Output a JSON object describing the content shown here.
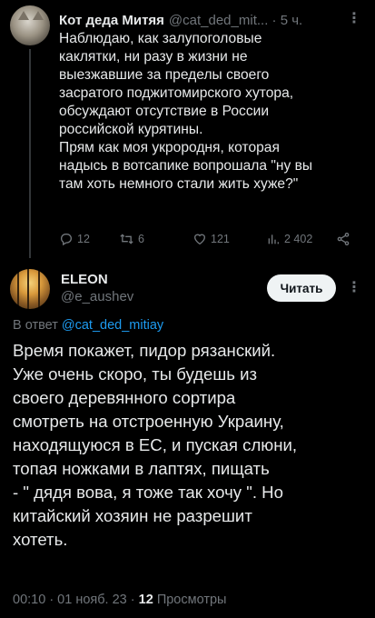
{
  "parent_tweet": {
    "author_name": "Кот деда Митяя",
    "handle": "@cat_ded_mit...",
    "separator": "·",
    "time": "5 ч.",
    "text_lines": [
      "Наблюдаю, как залупоголовые",
      "каклятки, ни разу в жизни не",
      "выезжавшие за пределы своего",
      "засратого поджитомирского хутора,",
      "обсуждают отсутствие в России",
      "российской курятины.",
      "Прям как моя укрородня, которая",
      "надысь в вотсапике вопрошала \"ну вы",
      "там хоть немного стали жить хуже?\""
    ],
    "replies": "12",
    "retweets": "6",
    "likes": "121",
    "views": "2 402"
  },
  "reply_tweet": {
    "author_name": "ELEON",
    "handle": "@e_aushev",
    "follow_label": "Читать",
    "reply_to_prefix": "В ответ",
    "reply_to_handle": "@cat_ded_mitiay",
    "text_lines": [
      "Время покажет, пидор рязанский.",
      "Уже очень скоро, ты будешь из",
      "своего деревянного сортира",
      "смотреть на отстроенную Украину,",
      "находящуюся в ЕС, и пуская слюни,",
      "топая ножками в лаптях, пищать",
      "- \" дядя вова, я тоже так хочу \". Но",
      "китайский хозяин не разрешит",
      "хотеть."
    ],
    "meta_time": "00:10 · 01 нояб. 23 ·",
    "views_count": "12",
    "views_label": "Просмотры"
  },
  "colors": {
    "background": "#000000",
    "text": "#e7e9ea",
    "secondary": "#71767b",
    "accent": "#1d9bf0"
  },
  "icons": [
    "reply-icon",
    "retweet-icon",
    "like-icon",
    "views-icon",
    "share-icon",
    "more-icon"
  ]
}
